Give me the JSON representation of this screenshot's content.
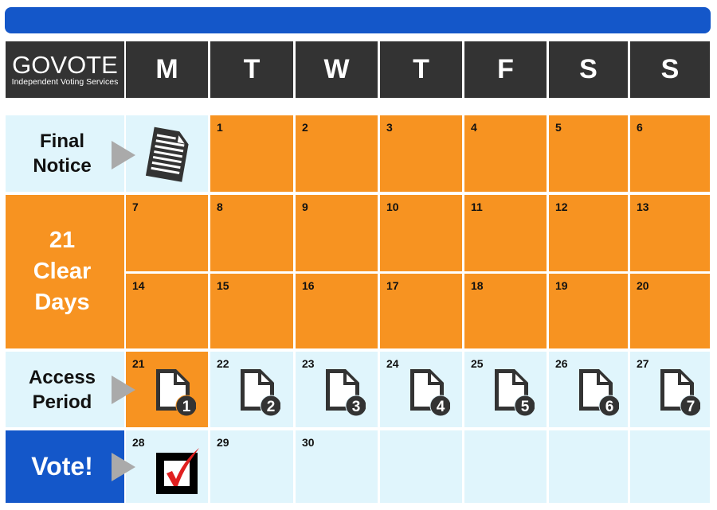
{
  "header": {
    "brand": "GOVOTE",
    "tagline": "Independent Voting Services",
    "days": [
      "M",
      "T",
      "W",
      "T",
      "F",
      "S",
      "S"
    ]
  },
  "rows": {
    "final_notice": {
      "label_line1": "Final",
      "label_line2": "Notice",
      "icon": "document-icon"
    },
    "clear_days": {
      "label_line1": "21",
      "label_line2": "Clear",
      "label_line3": "Days"
    },
    "access_period": {
      "label_line1": "Access",
      "label_line2": "Period",
      "icon": "numbered-document-icon"
    },
    "vote": {
      "label": "Vote!",
      "icon": "checked-ballot-icon"
    }
  },
  "weeks": [
    [
      "",
      "1",
      "2",
      "3",
      "4",
      "5",
      "6"
    ],
    [
      "7",
      "8",
      "9",
      "10",
      "11",
      "12",
      "13"
    ],
    [
      "14",
      "15",
      "16",
      "17",
      "18",
      "19",
      "20"
    ],
    [
      "21",
      "22",
      "23",
      "24",
      "25",
      "26",
      "27"
    ],
    [
      "28",
      "29",
      "30",
      "",
      "",
      "",
      ""
    ]
  ],
  "access_badges": [
    "1",
    "2",
    "3",
    "4",
    "5",
    "6",
    "7"
  ],
  "colors": {
    "brand_blue": "#1457c9",
    "orange": "#f79321",
    "light_blue": "#e0f5fc",
    "header_dark": "#333333",
    "check_red": "#e02020"
  }
}
